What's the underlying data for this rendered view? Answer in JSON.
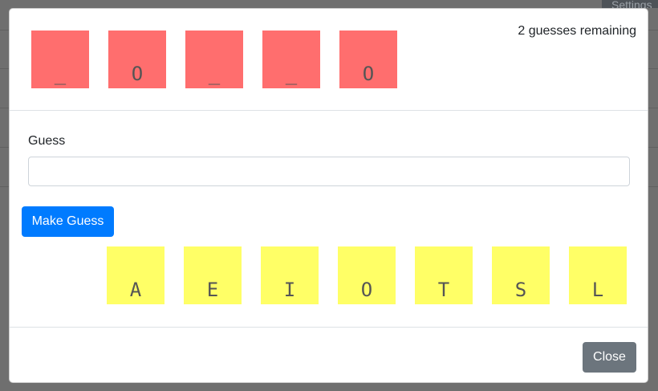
{
  "background": {
    "settings_label": "Settings"
  },
  "modal": {
    "revealed_word": [
      "_",
      "O",
      "_",
      "_",
      "O"
    ],
    "remaining_text": "2 guesses remaining",
    "guess_label": "Guess",
    "guess_value": "",
    "guess_placeholder": "",
    "make_guess_label": "Make Guess",
    "guessed_letters": [
      "A",
      "E",
      "I",
      "O",
      "T",
      "S",
      "L"
    ],
    "close_label": "Close"
  },
  "colors": {
    "word_tile": "#ff6e6e",
    "letter_tile": "#ffff66",
    "primary_button": "#007bff",
    "secondary_button": "#6c757d"
  }
}
